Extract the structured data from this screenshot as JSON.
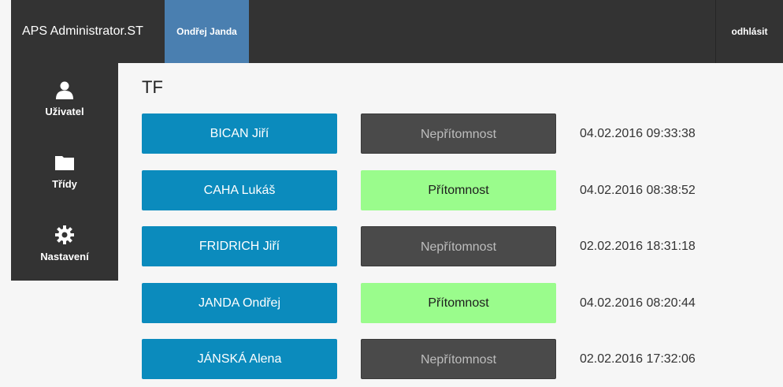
{
  "header": {
    "brand": "APS Administrator.ST",
    "user_tab": "Ondřej Janda",
    "logout": "odhlásit"
  },
  "sidebar": {
    "items": [
      {
        "label": "Uživatel",
        "icon": "user-icon"
      },
      {
        "label": "Třídy",
        "icon": "folder-icon"
      },
      {
        "label": "Nastavení",
        "icon": "gear-icon"
      }
    ]
  },
  "main": {
    "title": "TF",
    "rows": [
      {
        "name": "BICAN Jiří",
        "status": "Nepřítomnost",
        "status_type": "absent",
        "timestamp": "04.02.2016 09:33:38"
      },
      {
        "name": "CAHA Lukáš",
        "status": "Přítomnost",
        "status_type": "present",
        "timestamp": "04.02.2016 08:38:52"
      },
      {
        "name": "FRIDRICH Jiří",
        "status": "Nepřítomnost",
        "status_type": "absent",
        "timestamp": "02.02.2016 18:31:18"
      },
      {
        "name": "JANDA Ondřej",
        "status": "Přítomnost",
        "status_type": "present",
        "timestamp": "04.02.2016 08:20:44"
      },
      {
        "name": "JÁNSKÁ Alena",
        "status": "Nepřítomnost",
        "status_type": "absent",
        "timestamp": "02.02.2016 17:32:06"
      }
    ]
  },
  "colors": {
    "topbar": "#333333",
    "user_tab": "#4a7fb0",
    "name_button": "#0b8bbd",
    "absent": "#4a4a4a",
    "present": "#9afc8c"
  }
}
